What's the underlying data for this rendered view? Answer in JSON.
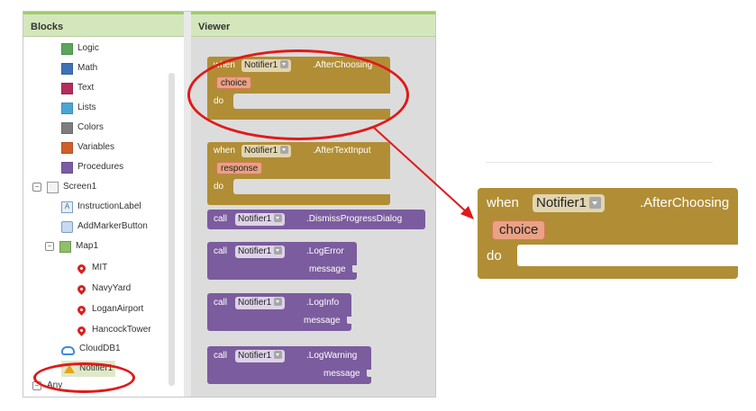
{
  "blocks_panel": {
    "title": "Blocks",
    "builtins": [
      {
        "label": "Logic",
        "color": "#5ba55b"
      },
      {
        "label": "Math",
        "color": "#3f71b5"
      },
      {
        "label": "Text",
        "color": "#b32d5e"
      },
      {
        "label": "Lists",
        "color": "#49a6d4"
      },
      {
        "label": "Colors",
        "color": "#7d7d7d"
      },
      {
        "label": "Variables",
        "color": "#d05f2d"
      },
      {
        "label": "Procedures",
        "color": "#7c5ba6"
      }
    ],
    "screen": "Screen1",
    "components": {
      "instruction_label": "InstructionLabel",
      "add_marker_button": "AddMarkerButton",
      "map": "Map1",
      "markers": [
        "MIT",
        "NavyYard",
        "LoganAirport",
        "HancockTower"
      ],
      "cloud_db": "CloudDB1",
      "notifier": "Notifier1",
      "partial_next": "Any"
    }
  },
  "viewer": {
    "title": "Viewer",
    "blocks": {
      "after_choosing": {
        "when": "when",
        "component": "Notifier1",
        "event": ".AfterChoosing",
        "param": "choice",
        "do": "do"
      },
      "after_text_input": {
        "when": "when",
        "component": "Notifier1",
        "event": ".AfterTextInput",
        "param": "response",
        "do": "do"
      },
      "dismiss": {
        "call": "call",
        "component": "Notifier1",
        "method": ".DismissProgressDialog"
      },
      "log_error": {
        "call": "call",
        "component": "Notifier1",
        "method": ".LogError",
        "arg": "message"
      },
      "log_info": {
        "call": "call",
        "component": "Notifier1",
        "method": ".LogInfo",
        "arg": "message"
      },
      "log_warning": {
        "call": "call",
        "component": "Notifier1",
        "method": ".LogWarning",
        "arg": "message"
      }
    }
  },
  "zoom": {
    "when": "when",
    "component": "Notifier1",
    "event": ".AfterChoosing",
    "param": "choice",
    "do": "do"
  },
  "colors": {
    "event_block": "#b18e35",
    "call_block": "#7b5c9e",
    "highlight": "#e01a1a",
    "header_bg": "#d4e7bc"
  }
}
